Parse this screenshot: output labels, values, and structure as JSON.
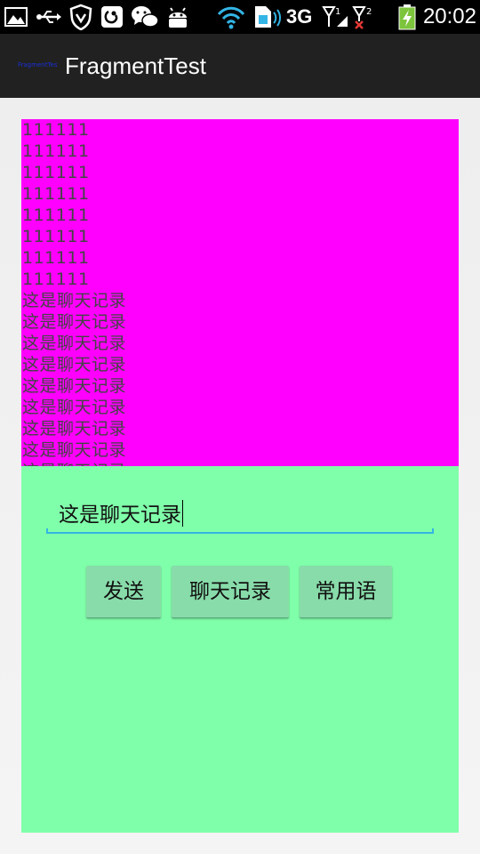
{
  "status_bar": {
    "time": "20:02",
    "network": "3G",
    "icons": [
      "gallery-icon",
      "usb-icon",
      "shield-icon",
      "app-icon",
      "wechat-icon",
      "android-icon",
      "wifi-icon",
      "sim-icon",
      "signal-icon",
      "battery-icon"
    ]
  },
  "action_bar": {
    "title": "FragmentTest",
    "logo_text": "FragmentTest"
  },
  "list_fragment": {
    "background": "#ff00ff",
    "lines": [
      "111111",
      "111111",
      "111111",
      "111111",
      "111111",
      "111111",
      "111111",
      "111111",
      "这是聊天记录",
      "这是聊天记录",
      "这是聊天记录",
      "这是聊天记录",
      "这是聊天记录",
      "这是聊天记录",
      "这是聊天记录",
      "这是聊天记录",
      "这是聊天记录"
    ]
  },
  "input_fragment": {
    "background": "#80ffaa",
    "input_value": "这是聊天记录",
    "buttons": {
      "send": "发送",
      "history": "聊天记录",
      "phrases": "常用语"
    }
  },
  "colors": {
    "accent": "#33b5e5",
    "button": "#88dcaa"
  }
}
